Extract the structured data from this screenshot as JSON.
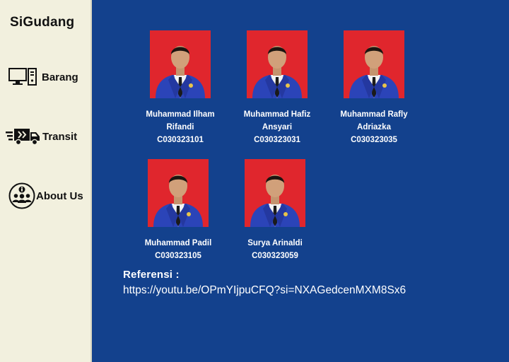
{
  "sidebar": {
    "brand": "SiGudang",
    "items": [
      {
        "label": "Barang",
        "icon": "computer-icon"
      },
      {
        "label": "Transit",
        "icon": "truck-icon"
      },
      {
        "label": "About Us",
        "icon": "team-info-icon"
      }
    ]
  },
  "team": [
    {
      "name_line1": "Muhammad Ilham",
      "name_line2": "Rifandi",
      "nim": "C030323101"
    },
    {
      "name_line1": "Muhammad Hafiz",
      "name_line2": "Ansyari",
      "nim": "C030323031"
    },
    {
      "name_line1": "Muhammad Rafly",
      "name_line2": "Adriazka",
      "nim": "C030323035"
    },
    {
      "name_line1": "Muhammad Padil",
      "nim": "C030323105"
    },
    {
      "name_line1": "Surya Arinaldi",
      "nim": "C030323059"
    }
  ],
  "reference": {
    "title": "Referensi :",
    "link": "https://youtu.be/OPmYIjpuCFQ?si=NXAGedcenMXM8Sx6"
  },
  "colors": {
    "main_background": "#13418d",
    "sidebar_background": "#f2f0de",
    "photo_background": "#e0262d",
    "jacket": "#2b44b8"
  }
}
